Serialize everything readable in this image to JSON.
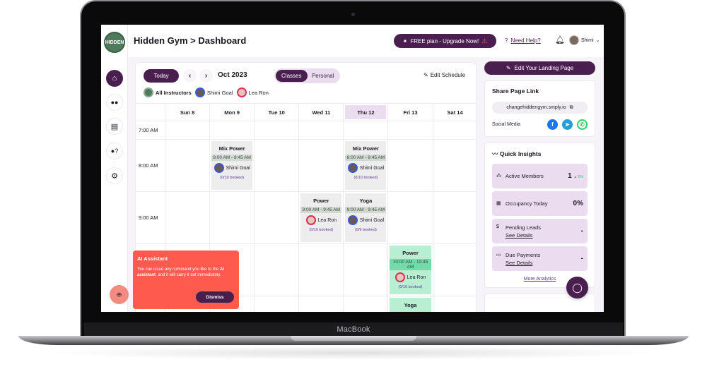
{
  "device": {
    "brand_label": "MacBook"
  },
  "app": {
    "title": "Hidden Gym > Dashboard",
    "logo_text": "HIDDEN",
    "upgrade_label": "FREE plan - Upgrade Now!",
    "help_label": "Need Help?",
    "user_name": "Shimi"
  },
  "sidebar": {
    "items": [
      {
        "name": "home",
        "icon": "⌂",
        "active": true
      },
      {
        "name": "members",
        "icon": "👥",
        "active": false
      },
      {
        "name": "classes",
        "icon": "▤",
        "active": false
      },
      {
        "name": "instructors",
        "icon": "👤",
        "active": false
      },
      {
        "name": "settings",
        "icon": "⚙",
        "active": false
      }
    ]
  },
  "calendar": {
    "today_label": "Today",
    "prev_icon": "‹",
    "next_icon": "›",
    "month_label": "Oct 2023",
    "toggle": [
      "Classes",
      "Personal"
    ],
    "toggle_selected": "Classes",
    "edit_label": "Edit Schedule",
    "instructors": [
      "All Instructors",
      "Shimi Goal",
      "Lea Ron"
    ],
    "days": [
      "Sun 8",
      "Mon 9",
      "Tue 10",
      "Wed 11",
      "Thu 12",
      "Fri 13",
      "Sat 14"
    ],
    "highlighted_day": "Thu 12",
    "times": [
      "7:00 AM",
      "8:00 AM",
      "9:00 AM"
    ],
    "events": [
      {
        "title": "Mix Power",
        "time": "8:00 AM - 8:45 AM",
        "instructor": "Shimi Goal",
        "booked": "(0/10 booked)"
      },
      {
        "title": "Mix Power",
        "time": "8:00 AM - 8:45 AM",
        "instructor": "Shimi Goal",
        "booked": "(0/10 booked)"
      },
      {
        "title": "Power",
        "time": "9:00 AM - 9:45 AM",
        "instructor": "Lea Ron",
        "booked": "(0/10 booked)"
      },
      {
        "title": "Yoga",
        "time": "9:00 AM - 9:45 AM",
        "instructor": "Shimi Goal",
        "booked": "(0/9 booked)"
      },
      {
        "title": "Power",
        "time": "10:00 AM - 10:45 AM",
        "instructor": "Lea Ron",
        "booked": "(0/10 booked)"
      },
      {
        "title": "Yoga",
        "time": "",
        "instructor": "",
        "booked": ""
      }
    ]
  },
  "right": {
    "landing_label": "Edit Your Landing Page",
    "share": {
      "title": "Share Page Link",
      "url": "changehiddengym.smply.io",
      "social_label": "Social Media"
    },
    "insights": {
      "title": "Quick Insights",
      "items": [
        {
          "label": "Active Members",
          "value": "1",
          "delta": "▲ 0%",
          "sub": ""
        },
        {
          "label": "Occupancy Today",
          "value": "0%",
          "delta": "",
          "sub": ""
        },
        {
          "label": "Pending Leads",
          "value": "-",
          "delta": "",
          "sub": "See Details"
        },
        {
          "label": "Due Payments",
          "value": "-",
          "delta": "",
          "sub": "See Details"
        }
      ],
      "more_label": "More Analytics"
    }
  },
  "ai": {
    "title": "AI Assistant",
    "text_pre": "You can issue any command you like to the ",
    "text_bold": "AI assistant",
    "text_post": ", and it will carry it out immediately.",
    "dismiss_label": "Dismiss"
  },
  "colors": {
    "brand": "#4a1f4f",
    "highlight": "#ecdcef",
    "ai_popup": "#ff5a4e",
    "event_green": "#b8efd3"
  }
}
